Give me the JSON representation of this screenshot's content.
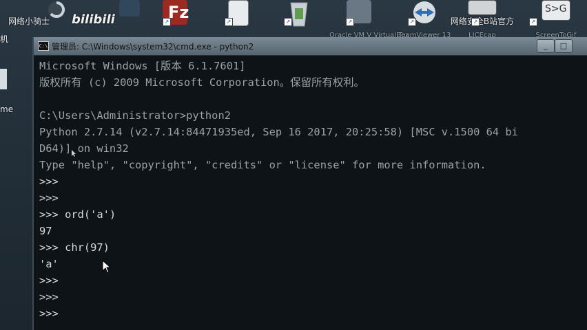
{
  "desktop": {
    "icons": [
      {
        "label": "网络小骑士",
        "name": "desktop-icon-net-knight"
      },
      {
        "label": "bilibili",
        "name": "desktop-icon-bilibili-1"
      },
      {
        "label": "",
        "name": "desktop-icon-blue-app"
      },
      {
        "label": "",
        "name": "desktop-icon-filezilla"
      },
      {
        "label": "",
        "name": "desktop-icon-text-editor"
      },
      {
        "label": "",
        "name": "desktop-icon-recycle-bin"
      },
      {
        "label": "Oracle VM V VirtualBox",
        "name": "desktop-icon-virtualbox"
      },
      {
        "label": "TeamViewer 13",
        "name": "desktop-icon-teamviewer"
      },
      {
        "label": "LICEcap",
        "name": "desktop-icon-licecap"
      },
      {
        "label": "网络安全B站官方",
        "name": "desktop-icon-netsec-bilibili"
      },
      {
        "label": "ScreenToGif",
        "name": "desktop-icon-screentogif"
      }
    ],
    "left_labels": [
      "机",
      "me"
    ]
  },
  "window": {
    "title": "管理员: C:\\Windows\\system32\\cmd.exe - python2",
    "icon_text": "C:\\"
  },
  "console": {
    "lines": [
      {
        "text": "Microsoft Windows [版本 6.1.7601]",
        "style": "dim"
      },
      {
        "text": "版权所有 (c) 2009 Microsoft Corporation。保留所有权利。",
        "style": "dim"
      },
      {
        "text": "",
        "style": "dim"
      },
      {
        "text": "C:\\Users\\Administrator>python2",
        "style": "dim"
      },
      {
        "text": "Python 2.7.14 (v2.7.14:84471935ed, Sep 16 2017, 20:25:58) [MSC v.1500 64 bi",
        "style": "dim"
      },
      {
        "text": "D64)] on win32",
        "style": "dim"
      },
      {
        "text": "Type \"help\", \"copyright\", \"credits\" or \"license\" for more information.",
        "style": "dim"
      },
      {
        "text": ">>>",
        "style": "white"
      },
      {
        "text": ">>>",
        "style": "white"
      },
      {
        "text": ">>> ord('a')",
        "style": "white"
      },
      {
        "text": "97",
        "style": "white"
      },
      {
        "text": ">>> chr(97)",
        "style": "white"
      },
      {
        "text": "'a'",
        "style": "white"
      },
      {
        "text": ">>>",
        "style": "white"
      },
      {
        "text": ">>>",
        "style": "white"
      },
      {
        "text": ">>>",
        "style": "white"
      }
    ]
  },
  "colors": {
    "console_bg": "#0d1316",
    "console_text": "#d6dadc",
    "titlebar": "#6a7a86"
  }
}
